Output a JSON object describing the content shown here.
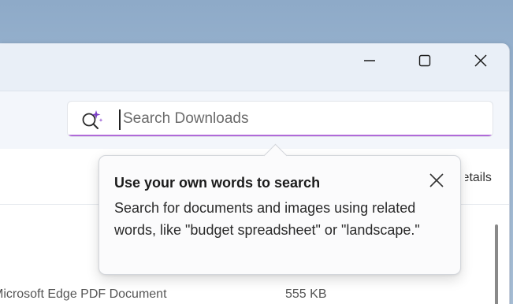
{
  "window": {
    "caption_buttons": [
      "minimize-icon",
      "maximize-icon",
      "close-icon"
    ]
  },
  "search": {
    "placeholder": "Search Downloads",
    "value": "",
    "icon": "ai-search-sparkle-icon",
    "accent_color": "#b06ad9"
  },
  "view": {
    "details_label": "Details"
  },
  "file_list": {
    "rows": [
      {
        "type": "Microsoft Edge PDF Document",
        "size": "555 KB"
      }
    ]
  },
  "teaching_tip": {
    "title": "Use your own words to search",
    "body": "Search for documents and images using related words, like \"budget spreadsheet\" or \"landscape.\"",
    "close_icon": "close-icon"
  }
}
